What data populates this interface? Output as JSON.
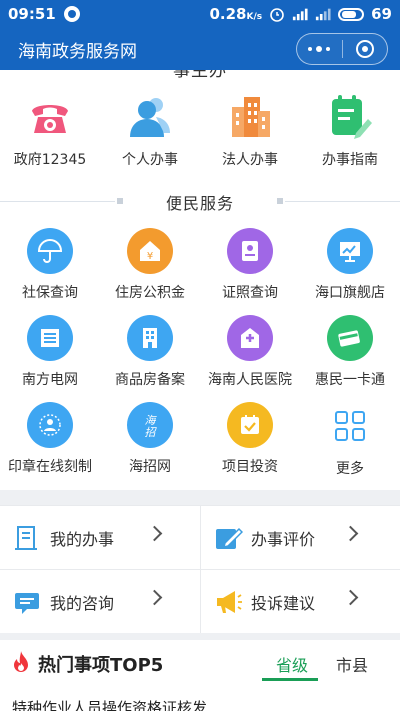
{
  "statusbar": {
    "time": "09:51",
    "speed": "0.28",
    "speed_unit": "K/s",
    "battery": "69"
  },
  "titlebar": {
    "title": "海南政务服务网"
  },
  "cut_section": {
    "title": "事主办"
  },
  "top_grid": [
    {
      "label": "政府12345",
      "icon": "telephone-icon",
      "color": "#f0577d"
    },
    {
      "label": "个人办事",
      "icon": "person-icon",
      "color": "#3b9de0"
    },
    {
      "label": "法人办事",
      "icon": "building-icon",
      "color": "#f08a3c"
    },
    {
      "label": "办事指南",
      "icon": "guide-icon",
      "color": "#2fbf71"
    }
  ],
  "convenience": {
    "title": "便民服务",
    "rows": [
      [
        {
          "label": "社保查询",
          "icon": "umbrella-icon",
          "color": "#3ea6f2"
        },
        {
          "label": "住房公积金",
          "icon": "house-fund-icon",
          "color": "#f39b2e"
        },
        {
          "label": "证照查询",
          "icon": "certificate-icon",
          "color": "#a067e6"
        },
        {
          "label": "海口旗舰店",
          "icon": "chart-board-icon",
          "color": "#3ea6f2"
        }
      ],
      [
        {
          "label": "南方电网",
          "icon": "power-grid-icon",
          "color": "#3ea6f2"
        },
        {
          "label": "商品房备案",
          "icon": "apartment-icon",
          "color": "#3ea6f2"
        },
        {
          "label": "海南人民医院",
          "icon": "hospital-icon",
          "color": "#a067e6"
        },
        {
          "label": "惠民一卡通",
          "icon": "card-icon",
          "color": "#2fbf71"
        }
      ],
      [
        {
          "label": "印章在线刻制",
          "icon": "seal-icon",
          "color": "#3ea6f2"
        },
        {
          "label": "海招网",
          "icon": "haizhao-logo-icon",
          "color": "#3ea6f2"
        },
        {
          "label": "项目投资",
          "icon": "calendar-check-icon",
          "color": "#f5b921"
        },
        {
          "label": "更多",
          "icon": "more-grid-icon",
          "color": "#3ea6f2"
        }
      ]
    ]
  },
  "quick_cards": [
    {
      "label": "我的办事",
      "icon": "document-icon"
    },
    {
      "label": "办事评价",
      "icon": "pencil-icon"
    },
    {
      "label": "我的咨询",
      "icon": "consult-icon"
    },
    {
      "label": "投诉建议",
      "icon": "megaphone-icon"
    }
  ],
  "hot": {
    "title": "热门事项TOP5",
    "tabs": [
      "省级",
      "市县"
    ],
    "first_item": "特种作业人员操作资格证核发"
  }
}
